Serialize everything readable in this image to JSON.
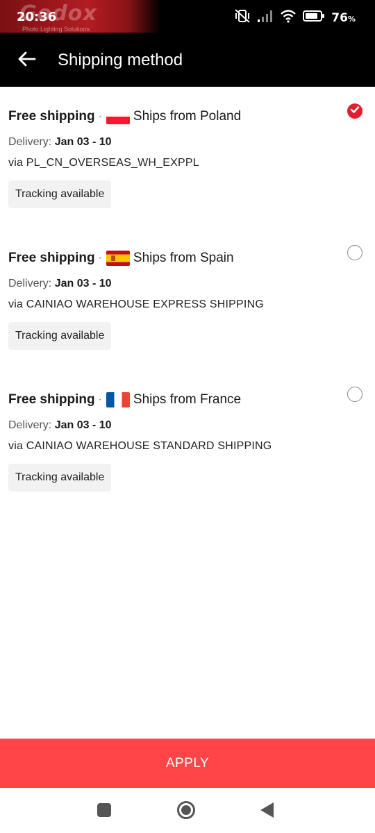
{
  "status_bar": {
    "time": "20:36",
    "battery": "76",
    "battery_unit": "%",
    "brand_logo": "Godox",
    "brand_tagline": "Photo Lighting Solutions"
  },
  "header": {
    "title": "Shipping method"
  },
  "options": [
    {
      "free": "Free shipping",
      "separator": "·",
      "ships_from": "Ships from Poland",
      "flag": "poland-flag",
      "delivery_label": "Delivery:",
      "delivery_date": "Jan 03 - 10",
      "carrier": "via PL_CN_OVERSEAS_WH_EXPPL",
      "tag": "Tracking available",
      "selected": true
    },
    {
      "free": "Free shipping",
      "separator": "·",
      "ships_from": "Ships from Spain",
      "flag": "spain-flag",
      "delivery_label": "Delivery:",
      "delivery_date": "Jan 03 - 10",
      "carrier": "via CAINIAO WAREHOUSE EXPRESS SHIPPING",
      "tag": "Tracking available",
      "selected": false
    },
    {
      "free": "Free shipping",
      "separator": "·",
      "ships_from": "Ships from France",
      "flag": "france-flag",
      "delivery_label": "Delivery:",
      "delivery_date": "Jan 03 - 10",
      "carrier": "via CAINIAO WAREHOUSE STANDARD SHIPPING",
      "tag": "Tracking available",
      "selected": false
    }
  ],
  "apply_label": "APPLY",
  "colors": {
    "accent": "#e0202e",
    "apply_bg": "#ff4548",
    "header_bg": "#000000"
  }
}
